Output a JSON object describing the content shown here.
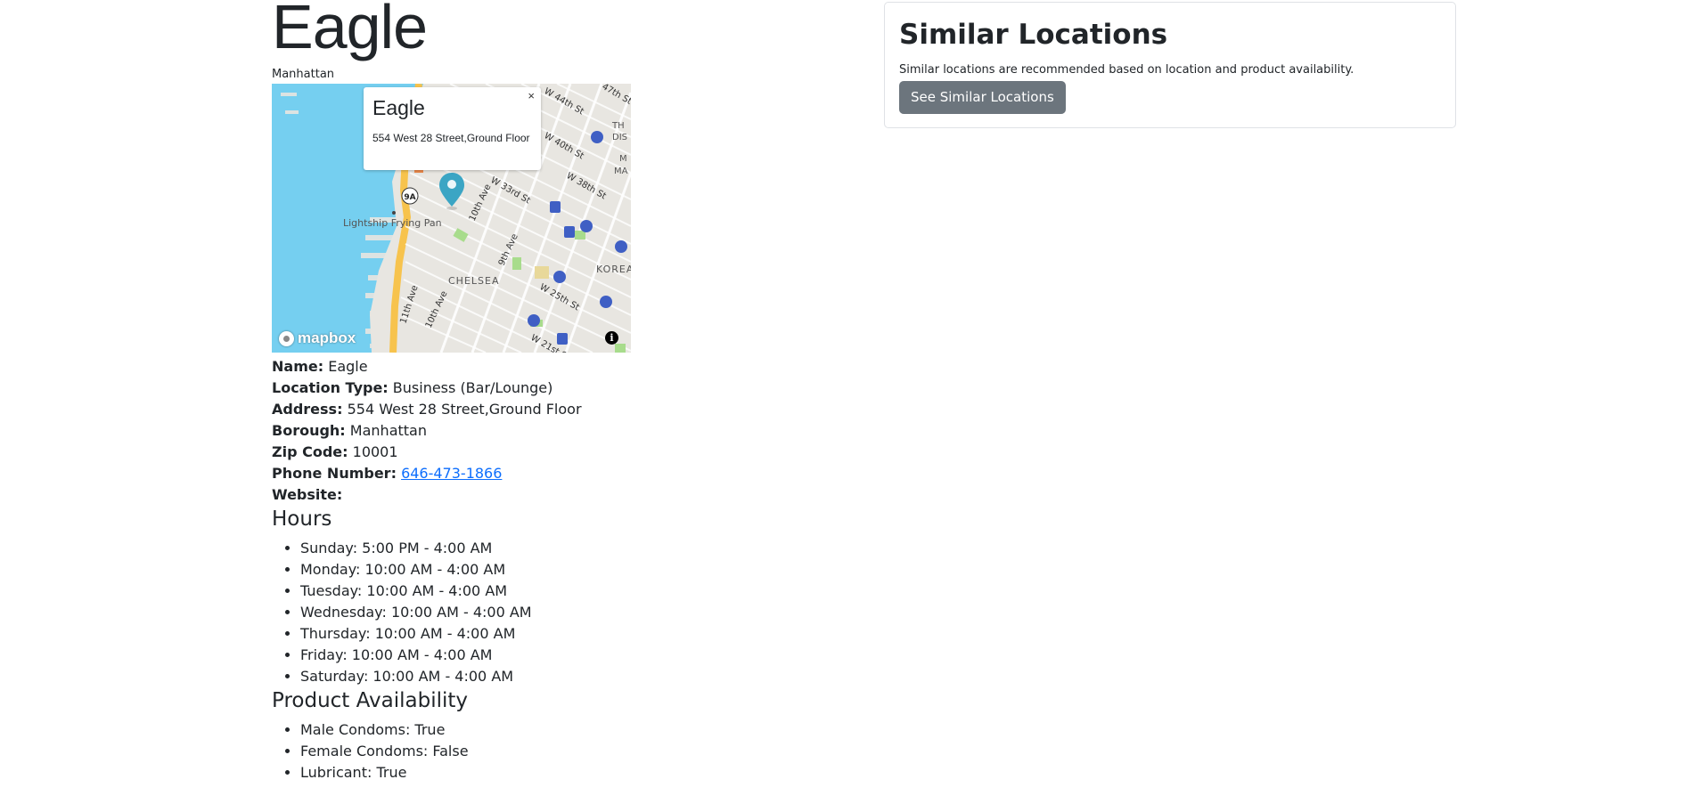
{
  "location": {
    "title": "Eagle",
    "borough_subtitle": "Manhattan"
  },
  "map": {
    "popup_title": "Eagle",
    "popup_address": "554 West 28 Street,Ground Floor",
    "popup_close": "×",
    "attribution_logo": "mapbox",
    "info_icon": "i",
    "labels": {
      "lightship": "Lightship Frying Pan",
      "chelsea": "CHELSEA",
      "korea": "KOREA",
      "eleventh_ave": "11th Ave",
      "tenth_ave_a": "10th Ave",
      "tenth_ave_b": "10th Ave",
      "ninth_ave": "9th Ave",
      "w44": "W 44th St",
      "w40": "W 40th St",
      "w38": "W 38th St",
      "w33": "W 33rd St",
      "w25": "W 25th St",
      "w21": "W 21st St",
      "w47": "47th St",
      "route_9a": "9A",
      "th_dis": "TH",
      "dis": "DIS",
      "ma": "MA",
      "m": "M"
    },
    "colors": {
      "water": "#75cff0",
      "land": "#e8e6e1",
      "highway": "#f7c34d",
      "park": "#a8dc8c",
      "marker": "#3ba5c4",
      "transit": "#3f5fc4"
    }
  },
  "details": {
    "name_label": "Name:",
    "name_value": "Eagle",
    "type_label": "Location Type:",
    "type_value": "Business (Bar/Lounge)",
    "address_label": "Address:",
    "address_value": "554 West 28 Street,Ground Floor",
    "borough_label": "Borough:",
    "borough_value": "Manhattan",
    "zip_label": "Zip Code:",
    "zip_value": "10001",
    "phone_label": "Phone Number:",
    "phone_value": "646-473-1866",
    "website_label": "Website:"
  },
  "hours": {
    "heading": "Hours",
    "items": [
      "Sunday: 5:00 PM - 4:00 AM",
      "Monday: 10:00 AM - 4:00 AM",
      "Tuesday: 10:00 AM - 4:00 AM",
      "Wednesday: 10:00 AM - 4:00 AM",
      "Thursday: 10:00 AM - 4:00 AM",
      "Friday: 10:00 AM - 4:00 AM",
      "Saturday: 10:00 AM - 4:00 AM"
    ]
  },
  "products": {
    "heading": "Product Availability",
    "items": [
      "Male Condoms: True",
      "Female Condoms: False",
      "Lubricant: True"
    ]
  },
  "similar": {
    "title": "Similar Locations",
    "description": "Similar locations are recommended based on location and product availability.",
    "button_label": "See Similar Locations"
  }
}
